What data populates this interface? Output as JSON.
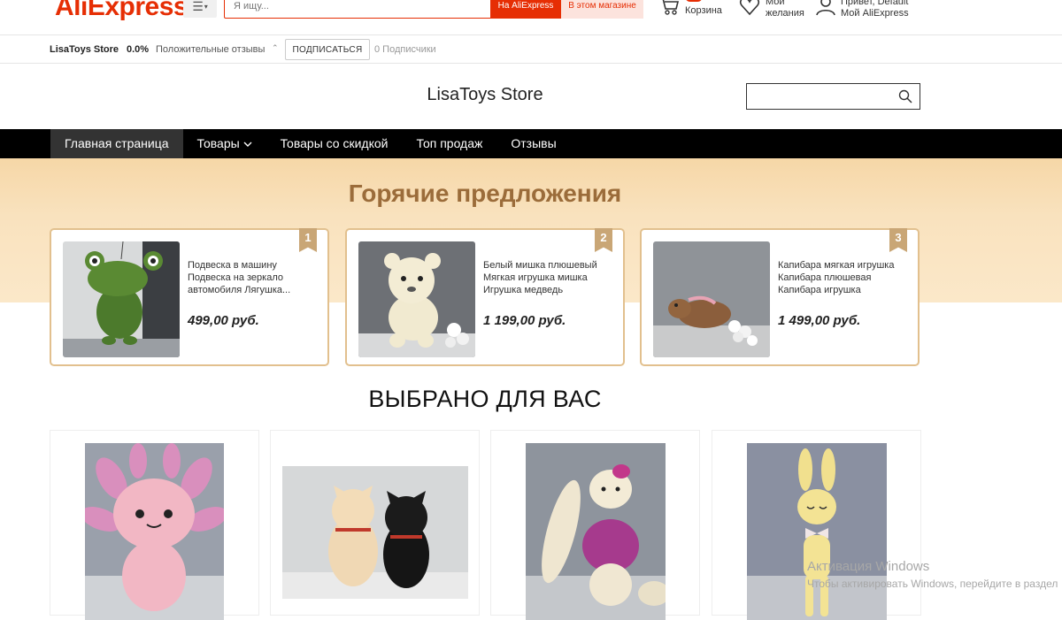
{
  "header": {
    "logo": "AliExpress",
    "search_placeholder": "Я ищу...",
    "search_aliexpress": "На AliExpress",
    "search_store": "В этом магазине",
    "cart_label": "Корзина",
    "wishlist_label_1": "Мои",
    "wishlist_label_2": "желания",
    "account_label_1": "Привет, Default",
    "account_label_2": "Мой AliExpress"
  },
  "store_bar": {
    "store_name": "LisaToys Store",
    "rating": "0.0%",
    "reviews_label": "Положительные отзывы",
    "subscribe": "ПОДПИСАТЬСЯ",
    "subscribers": "0 Подписчики"
  },
  "store_title": "LisaToys Store",
  "nav": {
    "items": [
      "Главная страница",
      "Товары",
      "Товары со скидкой",
      "Топ продаж",
      "Отзывы"
    ]
  },
  "hot": {
    "title": "Горячие предложения",
    "cards": [
      {
        "rank": "1",
        "title": "Подвеска в машину Подвеска на зеркало автомобиля Лягушка...",
        "price": "499,00 руб.",
        "image": "frog"
      },
      {
        "rank": "2",
        "title": "Белый мишка плюшевый Мягкая игрушка мишка Игрушка медведь",
        "price": "1 199,00 руб.",
        "image": "bear"
      },
      {
        "rank": "3",
        "title": "Капибара мягкая игрушка Капибара плюшевая Капибара игрушка",
        "price": "1 499,00 руб.",
        "image": "capybara"
      }
    ]
  },
  "picked": {
    "title": "ВЫБРАНО ДЛЯ ВАС",
    "items": [
      {
        "image": "axolotl"
      },
      {
        "image": "bulldogs"
      },
      {
        "image": "bunny-dress"
      },
      {
        "image": "bunny-yellow"
      }
    ]
  },
  "watermark": {
    "line1": "Активация Windows",
    "line2": "Чтобы активировать Windows, перейдите в раздел"
  },
  "colors": {
    "brand": "#e62e04",
    "accent_gold": "#c9a676",
    "nav_bg": "#000000"
  }
}
